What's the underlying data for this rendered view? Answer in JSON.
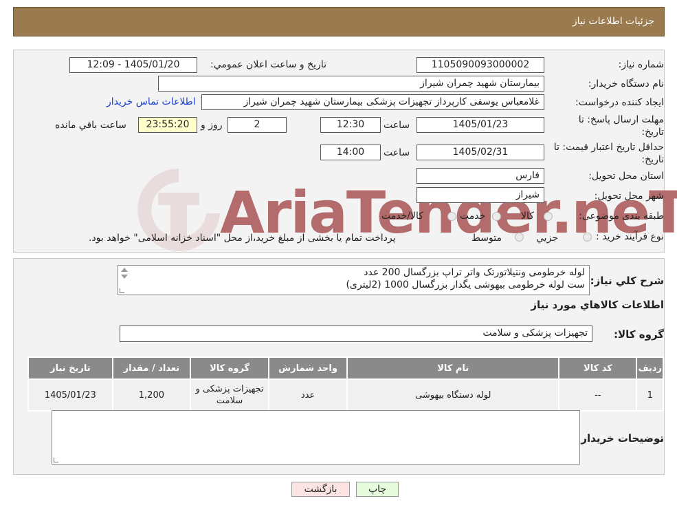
{
  "header": {
    "title": "جزئيات اطلاعات نياز"
  },
  "form": {
    "need_number_label": "شماره نياز:",
    "need_number": "1105090093000002",
    "announce_label": "تاريخ و ساعت اعلان عمومي:",
    "announce_value": "1405/01/20 - 12:09",
    "buyer_org_label": "نام دستگاه خريدار:",
    "buyer_org": "بيمارستان شهيد چمران شيراز",
    "requester_label": "ايجاد كننده درخواست:",
    "requester": "غلامعباس  يوسفی كارپرداز تجهيزات پزشكی بيمارستان شهيد چمران شيراز",
    "contact_link": "اطلاعات تماس خريدار",
    "reply_deadline_label_1": "مهلت ارسال پاسخ: تا",
    "reply_deadline_label_2": "تاريخ:",
    "reply_date": "1405/01/23",
    "time_label": "ساعت",
    "reply_time": "12:30",
    "days_value": "2",
    "days_label": "روز و",
    "remaining_time": "23:55:20",
    "remaining_label": "ساعت باقي مانده",
    "price_validity_label_1": "حداقل تاريخ اعتبار قيمت: تا",
    "price_validity_label_2": "تاريخ:",
    "price_validity_date": "1405/02/31",
    "price_validity_time": "14:00",
    "province_label": "استان محل تحويل:",
    "province": "فارس",
    "city_label": "شهر محل تحويل:",
    "city": "شيراز",
    "category_label": "طبقه بندی موضوعی:",
    "category_options": [
      "كالا",
      "خدمت",
      "كالا/خدمت"
    ],
    "process_label": "نوع فرآيند خريد :",
    "process_options": [
      "جزيي",
      "متوسط"
    ],
    "process_note": "پرداخت تمام يا بخشی از مبلغ خريد،از محل \"اسناد خزانه اسلامی\" خواهد بود."
  },
  "summary": {
    "label": "شرح كلي نياز:",
    "line1": "لوله خرطومی ونتیلاتورتک واتر تراپ بزرگسال 200 عدد",
    "line2": "ست لوله خرطومی بیهوشی یگدار بزرگسال 1000 (2لیتری)"
  },
  "goods_info_title": "اطلاعات كالاهاي مورد نياز",
  "goods_group_label": "گروه كالا:",
  "goods_group": "تجهيزات پزشكی و سلامت",
  "table": {
    "headers": [
      "رديف",
      "كد كالا",
      "نام كالا",
      "واحد شمارش",
      "گروه كالا",
      "تعداد / مقدار",
      "تاريخ نياز"
    ],
    "rows": [
      {
        "row": "1",
        "code": "--",
        "name": "لوله دستگاه بیهوشی",
        "unit": "عدد",
        "group": "تجهيزات پزشكی و سلامت",
        "qty": "1,200",
        "date": "1405/01/23"
      }
    ]
  },
  "buyer_notes_label": "توضيحات خريدار:",
  "buttons": {
    "print": "چاپ",
    "back": "بازگشت"
  },
  "watermark": "AriaTender.neT",
  "colors": {
    "header": "#9a7b4f",
    "print_btn": "#e6fbdc",
    "back_btn": "#fbe3e3",
    "link": "#1a3fd0"
  }
}
